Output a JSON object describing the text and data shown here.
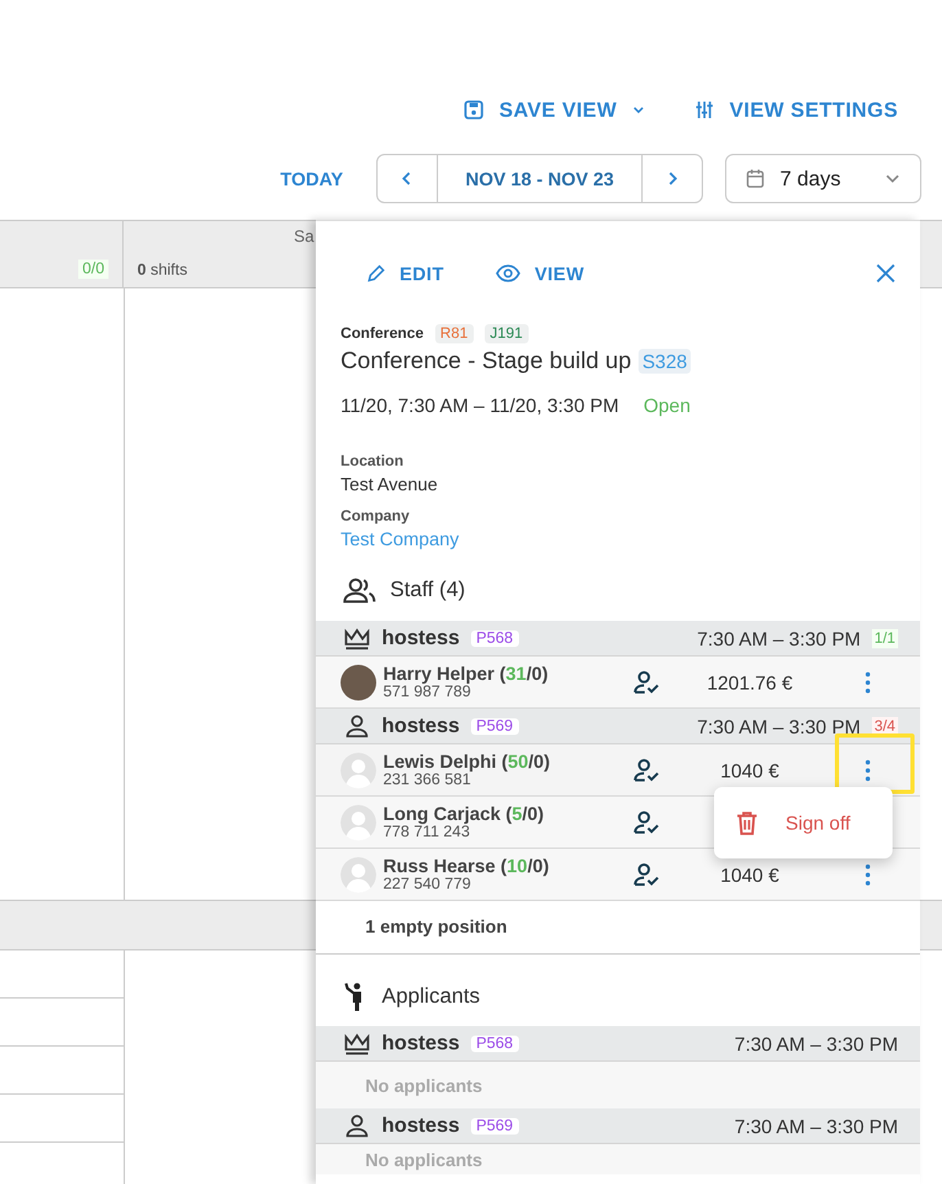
{
  "toolbar": {
    "save_view": "SAVE VIEW",
    "view_settings": "VIEW SETTINGS",
    "today": "TODAY",
    "date_range": "NOV 18 - NOV 23",
    "period": "7 days"
  },
  "calendar": {
    "column_1_badge": "0/0",
    "column_2_count": "0",
    "column_2_label": "shifts",
    "column_3_heading": "Sa"
  },
  "panel": {
    "edit": "EDIT",
    "view": "VIEW",
    "category": "Conference",
    "tags": [
      {
        "text": "R81",
        "color": "#e8703a"
      },
      {
        "text": "J191",
        "color": "#2e8b57"
      }
    ],
    "title": "Conference - Stage build up",
    "title_tag": "S328",
    "datetime": "11/20, 7:30 AM – 11/20, 3:30 PM",
    "status": "Open",
    "location_label": "Location",
    "location": "Test Avenue",
    "company_label": "Company",
    "company": "Test Company",
    "staff_title": "Staff (4)",
    "staff_groups": [
      {
        "role": "hostess",
        "code": "P568",
        "time": "7:30 AM – 3:30 PM",
        "filled": "1/1",
        "full": true,
        "members": [
          {
            "name": "Harry Helper (",
            "score": "31",
            "rest": "/0)",
            "phone": "571 987 789",
            "pay": "1201.76 €",
            "highlighted": false
          }
        ]
      },
      {
        "role": "hostess",
        "code": "P569",
        "time": "7:30 AM – 3:30 PM",
        "filled": "3/4",
        "full": false,
        "members": [
          {
            "name": "Lewis Delphi (",
            "score": "50",
            "rest": "/0)",
            "phone": "231 366 581",
            "pay": "1040 €",
            "highlighted": true
          },
          {
            "name": "Long Carjack (",
            "score": "5",
            "rest": "/0)",
            "phone": "778 711 243",
            "highlighted": false
          },
          {
            "name": "Russ Hearse (",
            "score": "10",
            "rest": "/0)",
            "phone": "227 540 779",
            "pay": "1040 €",
            "highlighted": false
          }
        ]
      }
    ],
    "empty_positions": "1 empty position",
    "menu": {
      "item": "Sign off"
    },
    "applicants_title": "Applicants",
    "applicant_groups": [
      {
        "role": "hostess",
        "code": "P568",
        "time": "7:30 AM – 3:30 PM",
        "empty": "No applicants"
      },
      {
        "role": "hostess",
        "code": "P569",
        "time": "7:30 AM – 3:30 PM",
        "empty": "No applicants"
      }
    ]
  }
}
